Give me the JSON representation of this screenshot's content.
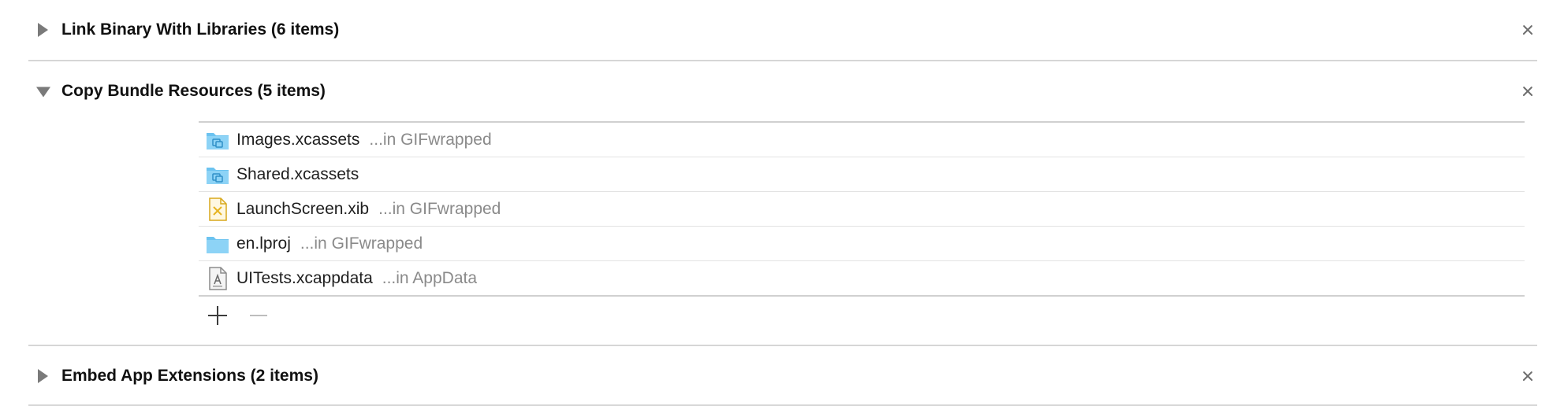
{
  "phases": [
    {
      "title": "Link Binary With Libraries (6 items)",
      "state": "collapsed",
      "remove_icon": "close-icon"
    },
    {
      "title": "Copy Bundle Resources (5 items)",
      "state": "expanded",
      "remove_icon": "close-icon",
      "files": [
        {
          "name": "Images.xcassets",
          "location": "...in GIFwrapped",
          "icon": "asset-catalog-icon"
        },
        {
          "name": "Shared.xcassets",
          "location": "",
          "icon": "asset-catalog-icon"
        },
        {
          "name": "LaunchScreen.xib",
          "location": "...in GIFwrapped",
          "icon": "xib-file-icon"
        },
        {
          "name": "en.lproj",
          "location": "...in GIFwrapped",
          "icon": "folder-icon"
        },
        {
          "name": "UITests.xcappdata",
          "location": "...in AppData",
          "icon": "app-data-icon"
        }
      ],
      "add_icon": "plus-icon",
      "remove_file_icon": "minus-icon"
    },
    {
      "title": "Embed App Extensions (2 items)",
      "state": "collapsed",
      "remove_icon": "close-icon"
    }
  ],
  "colors": {
    "folder_blue": "#6cc3f0",
    "xib_yellow": "#e6b422",
    "separator": "#d6d6d6",
    "secondary_text": "#8a8a8a"
  }
}
